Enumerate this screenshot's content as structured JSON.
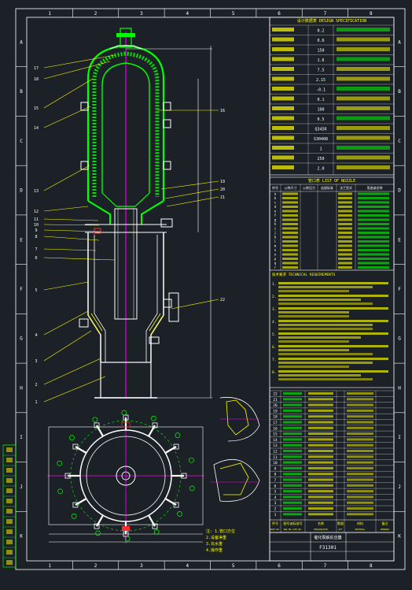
{
  "colors": {
    "background": "#1c2127",
    "frame": "#ffffff",
    "vessel": "#00ff00",
    "centerline": "#ff00ff",
    "annotation": "#ffff00",
    "nozzle": "#00ffff",
    "accent_red": "#ff3030"
  },
  "grid": {
    "columns": [
      "1",
      "2",
      "3",
      "4",
      "5",
      "6",
      "7",
      "8"
    ],
    "rows": [
      "A",
      "B",
      "C",
      "D",
      "E",
      "F",
      "G",
      "H",
      "I",
      "J",
      "K"
    ]
  },
  "leaders": {
    "left": [
      "17",
      "18",
      "15",
      "14",
      "13",
      "12",
      "11",
      "10",
      "9",
      "8",
      "7",
      "6",
      "5",
      "4",
      "3",
      "2",
      "1"
    ],
    "right": [
      "16",
      "19",
      "20",
      "21",
      "22"
    ]
  },
  "spec_table": {
    "heading": "设计数据表 DESIGN SPECIFICATION",
    "rows": [
      "0.2",
      "0.6",
      "150",
      "1.6",
      "7.5",
      "2.15",
      "-0.1",
      "0.1",
      "100",
      "0.5",
      "Q345R",
      "S30408",
      "1",
      "250",
      "2.0"
    ]
  },
  "nozzle_table": {
    "heading": "管口表 LIST OF NOZZLE",
    "columns": [
      "符号",
      "公称尺寸",
      "公称压力",
      "连接标准",
      "法兰型式",
      "用途或名称"
    ],
    "marks": [
      "a",
      "b",
      "c",
      "d",
      "e",
      "f",
      "g",
      "h",
      "i",
      "j",
      "k",
      "l",
      "m",
      "n",
      "o",
      "p",
      "q",
      "r"
    ]
  },
  "tech_notes": {
    "heading": "技术要求 TECHNICAL REQUIREMENTS",
    "items": [
      "1.",
      "2.",
      "3.",
      "4.",
      "5.",
      "6.",
      "7.",
      "8."
    ]
  },
  "parts_list": {
    "numbers": [
      "22",
      "21",
      "20",
      "19",
      "18",
      "17",
      "16",
      "15",
      "14",
      "13",
      "12",
      "11",
      "10",
      "9",
      "8",
      "7",
      "6",
      "5",
      "4",
      "3",
      "2",
      "1"
    ],
    "footer_labels": [
      "件号",
      "图号或标准号",
      "名称",
      "数量",
      "材料",
      "备注"
    ],
    "footer_labels_en": [
      "PART NO.",
      "DWG NO./STD NO.",
      "DESIGNATION",
      "QTY",
      "MATERIAL",
      "REMARKS"
    ]
  },
  "title_block": {
    "drawing_no": "F31301",
    "name": "催化裂解反应器"
  },
  "plan_notes": [
    "注: 1.管口方位",
    "2.设备净重",
    "3.充水重",
    "4.操作重"
  ]
}
